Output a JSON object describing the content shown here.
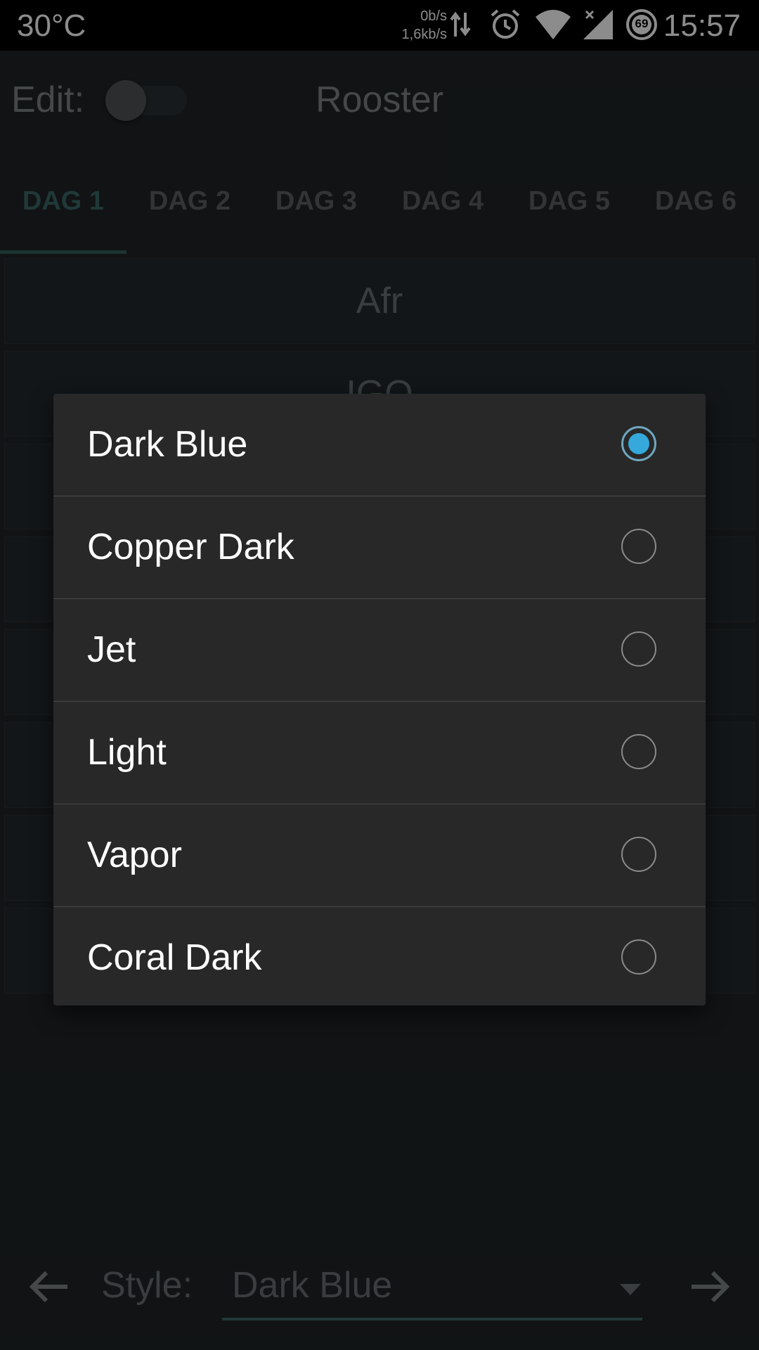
{
  "status_bar": {
    "temperature": "30°C",
    "net_down": "0b/s",
    "net_up": "1,6kb/s",
    "battery_level": "69",
    "time": "15:57"
  },
  "header": {
    "edit_label": "Edit:",
    "edit_toggle_on": false,
    "title": "Rooster"
  },
  "tabs": {
    "items": [
      "DAG 1",
      "DAG 2",
      "DAG 3",
      "DAG 4",
      "DAG 5",
      "DAG 6"
    ],
    "active_index": 0
  },
  "schedule_rows": [
    "Afr",
    "IGO",
    "",
    "",
    "",
    "",
    "",
    ""
  ],
  "style_dialog": {
    "options": [
      "Dark Blue",
      "Copper Dark",
      "Jet",
      "Light",
      "Vapor",
      "Coral Dark"
    ],
    "selected": "Dark Blue",
    "accent_color": "#35a8dc"
  },
  "bottom_bar": {
    "style_label": "Style:",
    "style_value": "Dark Blue",
    "prev_icon": "arrow-left-icon",
    "next_icon": "arrow-right-icon"
  },
  "colors": {
    "background": "#1f2427",
    "dialog": "#282828",
    "tab_active": "#3b6967",
    "accent": "#35a8dc"
  }
}
